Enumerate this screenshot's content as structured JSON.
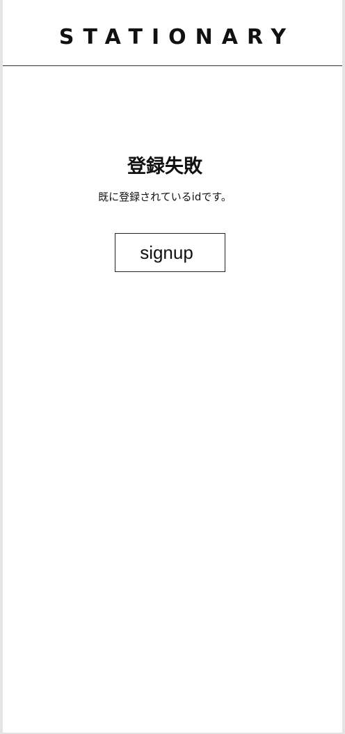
{
  "header": {
    "logo_text": "STATIONARY"
  },
  "main": {
    "title": "登録失敗",
    "message": "既に登録されているidです。",
    "signup_label": "signup"
  },
  "colors": {
    "background": "#ffffff",
    "text": "#111111",
    "border": "#333333",
    "outer": "#e4e4e4"
  }
}
